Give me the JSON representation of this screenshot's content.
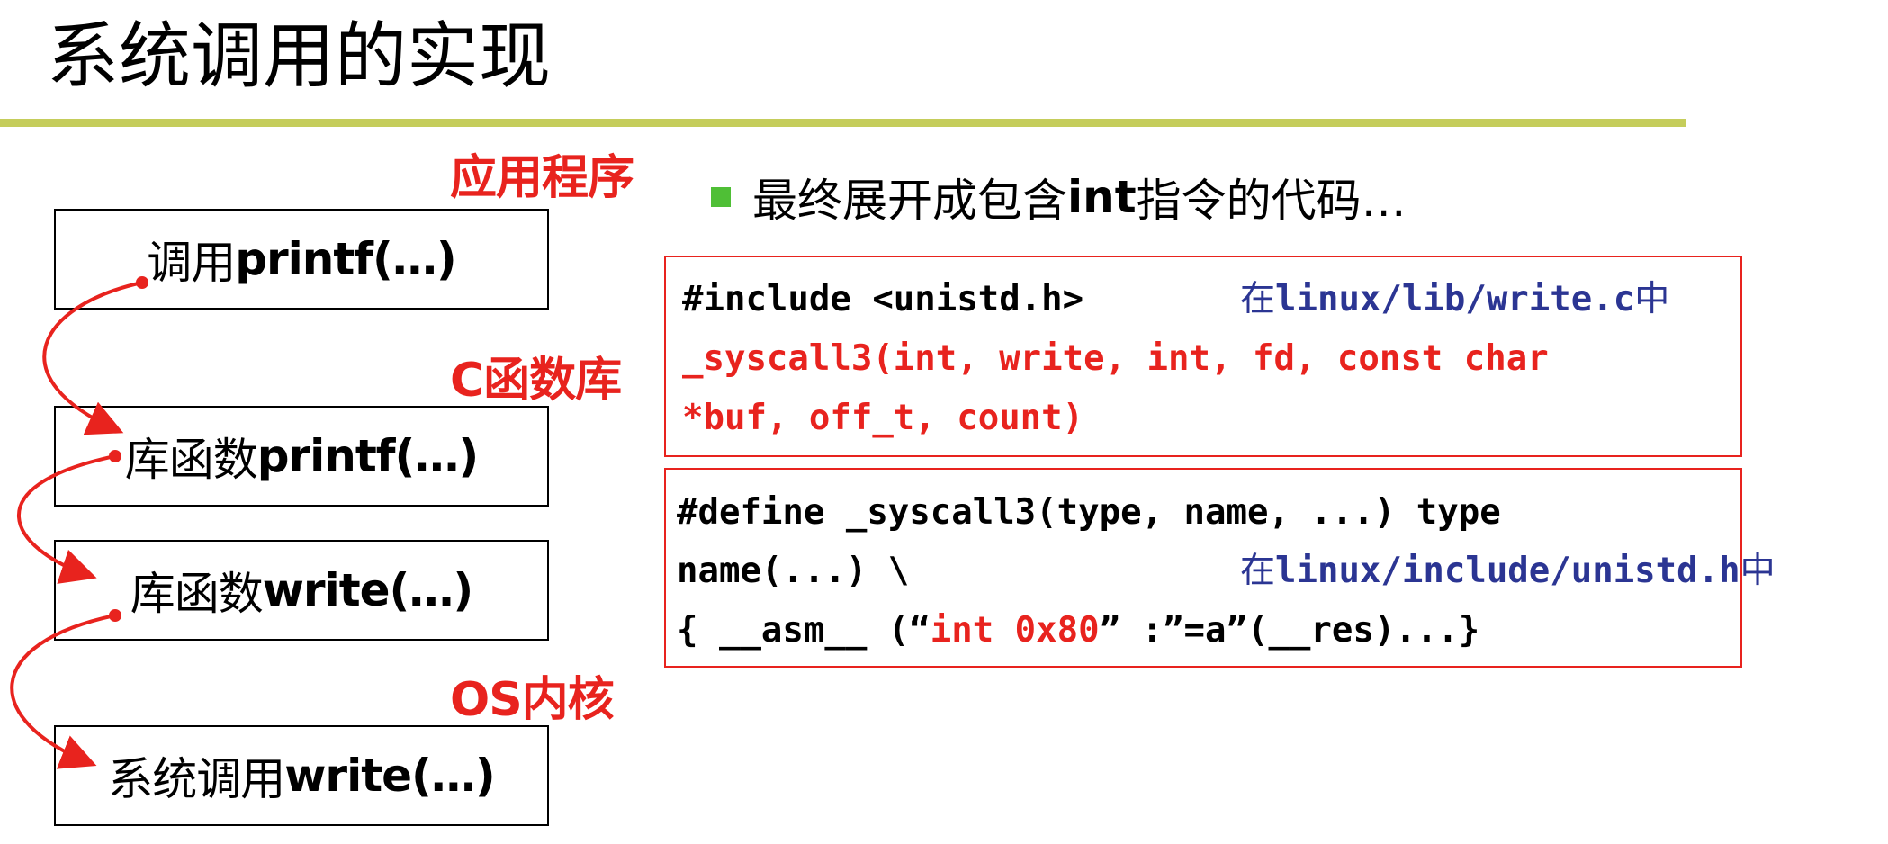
{
  "slide": {
    "title": "系统调用的实现"
  },
  "layers": {
    "app": "应用程序",
    "clib": "C函数库",
    "os": "OS内核"
  },
  "boxes": [
    {
      "cn": "调用",
      "en": "printf(…)"
    },
    {
      "cn": "库函数",
      "en": "printf(…)"
    },
    {
      "cn": "库函数",
      "en": "write(…)"
    },
    {
      "cn": "系统调用",
      "en": "write(…)"
    }
  ],
  "bullet": {
    "pre": "最终展开成包含",
    "keyword": "int",
    "post": "指令的代码…"
  },
  "code1": {
    "include": "#include <unistd.h>",
    "note_pre": "在",
    "note_path": "linux/lib/write.c",
    "note_post": "中",
    "line2": "_syscall3(int, write, int, fd, const char",
    "line3": "*buf, off_t, count)"
  },
  "code2": {
    "line1": "#define _syscall3(type, name, ...) type",
    "line2": "name(...) \\",
    "note_pre": "在",
    "note_path": "linux/include/unistd.h",
    "note_post": "中",
    "line3_a": "{ __asm__ (“",
    "line3_b": "int 0x80",
    "line3_c": "” :”=a”(__res)...}"
  },
  "colors": {
    "accent_red": "#e8231e",
    "note_blue": "#2b3593",
    "rule_green": "#c5cd5b",
    "bullet_green": "#4fbf36"
  }
}
